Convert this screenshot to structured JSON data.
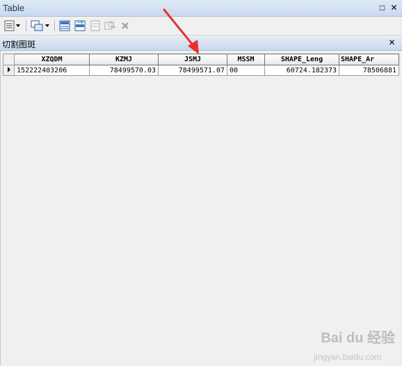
{
  "window": {
    "title": "Table",
    "restore_glyph": "□",
    "close_glyph": "✕"
  },
  "toolbar": {
    "icons": [
      "table-options-icon",
      "related-tables-icon",
      "select-by-attributes-icon",
      "switch-selection-icon",
      "clear-selection-icon",
      "zoom-to-selected-icon",
      "delete-selected-icon"
    ]
  },
  "tab": {
    "name": "切割图斑",
    "close_glyph": "✕"
  },
  "table": {
    "columns": [
      "XZQDM",
      "KZMJ",
      "JSMJ",
      "MSSM",
      "SHAPE_Leng",
      "SHAPE_Ar"
    ],
    "rows": [
      {
        "XZQDM": "152222403206",
        "KZMJ": "78499570.03",
        "JSMJ": "78499571.07",
        "MSSM": "00",
        "SHAPE_Leng": "60724.182373",
        "SHAPE_Ar": "78506881"
      }
    ]
  },
  "watermark": {
    "brand": "Bai du 经验",
    "url": "jingyan.baidu.com"
  },
  "colors": {
    "annotation_arrow": "#e8312f",
    "titlebar": "#c9d9ee"
  }
}
